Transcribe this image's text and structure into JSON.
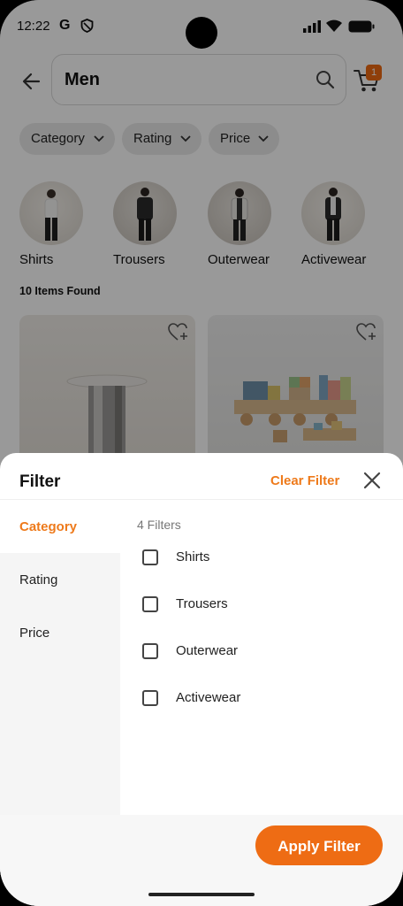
{
  "status": {
    "time": "12:22",
    "g_label": "G"
  },
  "header": {
    "search_value": "Men",
    "cart_count": "1"
  },
  "chips": [
    {
      "label": "Category"
    },
    {
      "label": "Rating"
    },
    {
      "label": "Price"
    }
  ],
  "categories": [
    {
      "label": "Shirts"
    },
    {
      "label": "Trousers"
    },
    {
      "label": "Outerwear"
    },
    {
      "label": "Activewear"
    }
  ],
  "items_found": "10 Items Found",
  "filter_sheet": {
    "title": "Filter",
    "clear_label": "Clear Filter",
    "tabs": [
      {
        "label": "Category"
      },
      {
        "label": "Rating"
      },
      {
        "label": "Price"
      }
    ],
    "active_tab": "Category",
    "filters_count": "4 Filters",
    "options": [
      {
        "label": "Shirts",
        "checked": false
      },
      {
        "label": "Trousers",
        "checked": false
      },
      {
        "label": "Outerwear",
        "checked": false
      },
      {
        "label": "Activewear",
        "checked": false
      }
    ],
    "apply_label": "Apply Filter"
  },
  "colors": {
    "accent": "#ee6c14",
    "chip_bg": "#e9e9e9",
    "nav_bg": "#f5f5f5"
  },
  "icons": [
    "back-arrow-icon",
    "search-icon",
    "cart-icon",
    "chevron-down-icon",
    "heart-add-icon",
    "close-icon",
    "signal-icon",
    "wifi-icon",
    "battery-icon",
    "shield-icon"
  ]
}
